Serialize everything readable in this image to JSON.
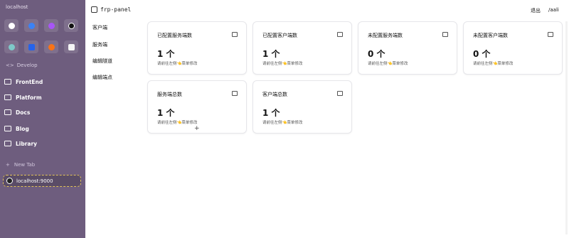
{
  "browser": {
    "url_title": "localhost",
    "develop_label": "Develop",
    "develop_icon": "code-icon",
    "favicons": [
      {
        "name": "github-icon",
        "color": "#ffffff"
      },
      {
        "name": "bluesky-icon",
        "color": "#3b82f6"
      },
      {
        "name": "chat-icon",
        "color": "#a855f7"
      },
      {
        "name": "triangle-icon",
        "color": "#111111"
      },
      {
        "name": "app-icon",
        "color": "#7ec8c8"
      },
      {
        "name": "zoom-icon",
        "color": "#2563eb"
      },
      {
        "name": "figma-icon",
        "color": "#f97316"
      },
      {
        "name": "notion-icon",
        "color": "#f5f5f5"
      }
    ],
    "folders": [
      "FrontEnd",
      "Platform",
      "Docs",
      "Blog",
      "Library"
    ],
    "new_tab_label": "New Tab",
    "active_tab": "localhost:9000"
  },
  "app": {
    "title": "frp-panel",
    "logout_label": "退出",
    "user_label": "/aali"
  },
  "nav": [
    "客户端",
    "服务端",
    "编辑隧道",
    "编辑端点"
  ],
  "cards": [
    {
      "title": "已配置服务端数",
      "value": "1 个",
      "hint": "请前往左侧👈菜单修改",
      "icon": "server-icon"
    },
    {
      "title": "已配置客户端数",
      "value": "1 个",
      "hint": "请前往左侧👈菜单修改",
      "icon": "thumbs-up-icon"
    },
    {
      "title": "未配置服务端数",
      "value": "0 个",
      "hint": "请前往左侧👈菜单修改",
      "icon": "server-off-icon"
    },
    {
      "title": "未配置客户端数",
      "value": "0 个",
      "hint": "请前往左侧👈菜单修改",
      "icon": "thumbs-off-icon"
    },
    {
      "title": "服务端总数",
      "value": "1 个",
      "hint": "请前往左侧👈菜单修改",
      "icon": "server-total-icon"
    },
    {
      "title": "客户端总数",
      "value": "1 个",
      "hint": "请前往左侧👈菜单修改",
      "icon": "client-total-icon"
    }
  ],
  "colors": {
    "sidebar_bg": "#6e5d7e",
    "active_tab_border": "#e3c35a"
  }
}
